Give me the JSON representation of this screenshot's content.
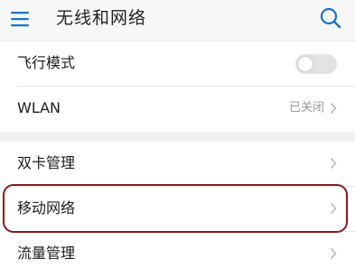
{
  "header": {
    "title": "无线和网络",
    "menu_icon": "hamburger-menu-icon",
    "search_icon": "search-icon"
  },
  "settings": {
    "group1": [
      {
        "label": "飞行模式",
        "control": "toggle",
        "toggle_state": "off"
      },
      {
        "label": "WLAN",
        "value": "已关闭"
      }
    ],
    "group2": [
      {
        "label": "双卡管理"
      },
      {
        "label": "移动网络",
        "highlighted": true
      },
      {
        "label": "流量管理"
      }
    ]
  },
  "colors": {
    "highlight_border": "#8b1a1a",
    "accent": "#1a73c9"
  }
}
